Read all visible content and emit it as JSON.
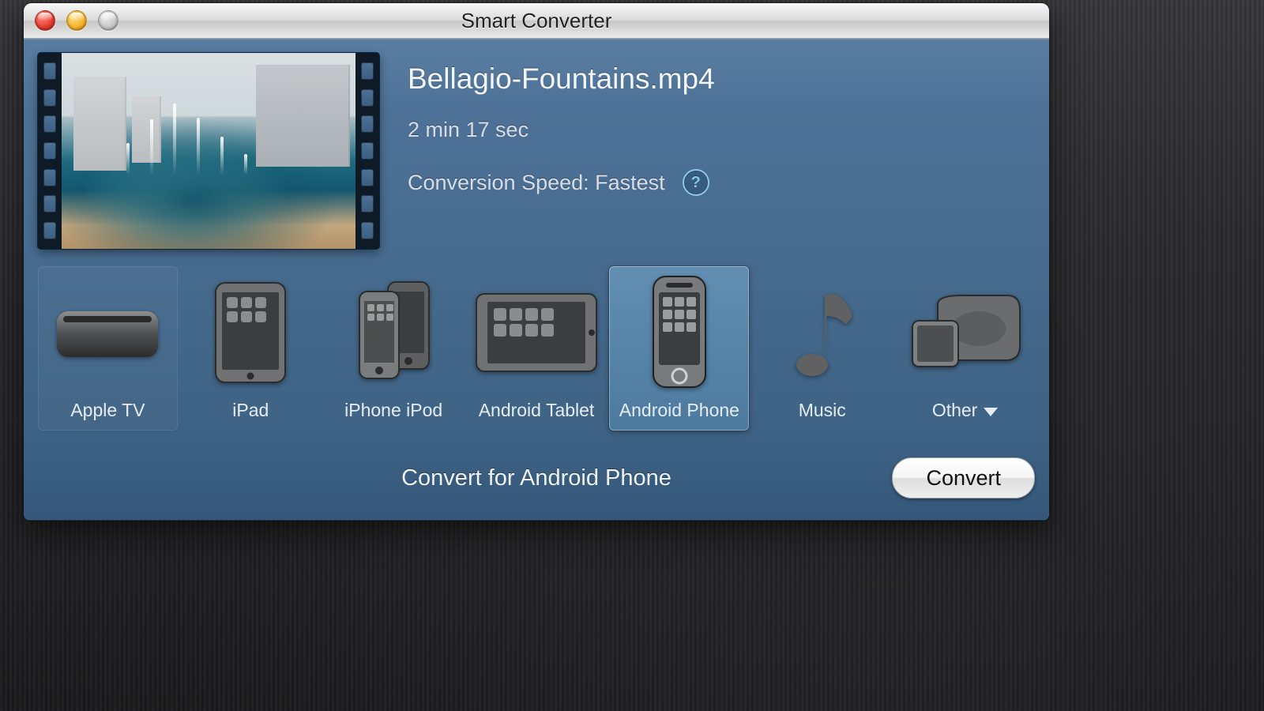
{
  "window": {
    "title": "Smart Converter"
  },
  "file": {
    "name": "Bellagio-Fountains.mp4",
    "duration": "2 min 17 sec",
    "speed_label": "Conversion Speed: Fastest"
  },
  "presets": {
    "items": [
      {
        "id": "apple-tv",
        "label": "Apple TV",
        "selected": false
      },
      {
        "id": "ipad",
        "label": "iPad",
        "selected": false
      },
      {
        "id": "iphone-ipod",
        "label": "iPhone iPod",
        "selected": false
      },
      {
        "id": "android-tablet",
        "label": "Android Tablet",
        "selected": false
      },
      {
        "id": "android-phone",
        "label": "Android Phone",
        "selected": true
      },
      {
        "id": "music",
        "label": "Music",
        "selected": false
      },
      {
        "id": "other",
        "label": "Other",
        "selected": false,
        "dropdown": true
      }
    ]
  },
  "action": {
    "target_label": "Convert for Android Phone",
    "button_label": "Convert"
  },
  "help_glyph": "?"
}
